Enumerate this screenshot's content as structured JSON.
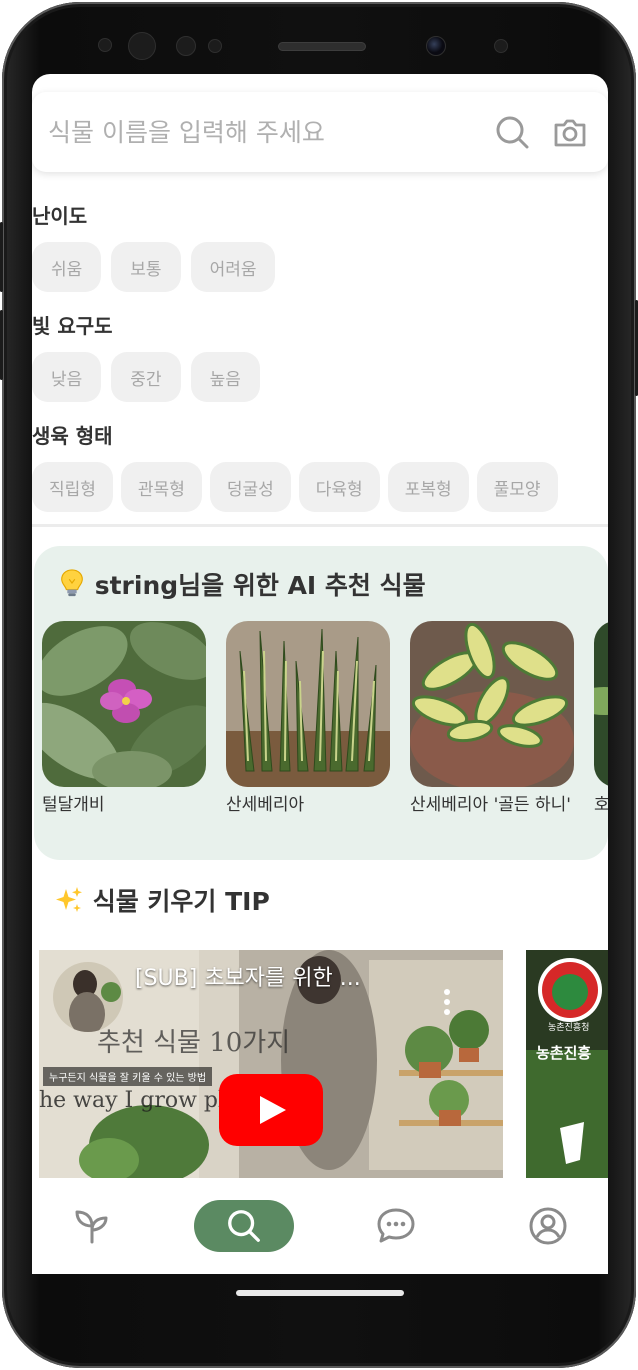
{
  "search": {
    "placeholder": "식물 이름을 입력해 주세요"
  },
  "filters": [
    {
      "title": "난이도",
      "options": [
        "쉬움",
        "보통",
        "어려움"
      ]
    },
    {
      "title": "빛 요구도",
      "options": [
        "낮음",
        "중간",
        "높음"
      ]
    },
    {
      "title": "생육 형태",
      "options": [
        "직립형",
        "관목형",
        "덩굴성",
        "다육형",
        "포복형",
        "풀모양"
      ]
    }
  ],
  "ai_section": {
    "user": "string",
    "title_suffix": "님을 위한 AI 추천 식물",
    "plants": [
      {
        "name": "털달개비"
      },
      {
        "name": "산세베리아"
      },
      {
        "name": "산세베리아 '골든 하니'"
      },
      {
        "name": "호"
      }
    ]
  },
  "tip_section": {
    "title": "식물 키우기 TIP"
  },
  "videos": [
    {
      "title": "[SUB] 초보자를 위한 ...",
      "overlay_line1": "추천 식물 10가지",
      "overlay_caption": "누구든지 식물을 잘 키울 수 있는 방법",
      "overlay_line2": "he way I grow pla"
    },
    {
      "channel": "농촌진흥청",
      "overlay_text": "농촌진흥"
    }
  ],
  "nav": [
    "plants-tab",
    "search-tab",
    "chat-tab",
    "profile-tab"
  ],
  "colors": {
    "accent": "#5b8a62",
    "ai_card_bg": "#e8f1ec",
    "chip_bg": "#f0f0f0"
  }
}
